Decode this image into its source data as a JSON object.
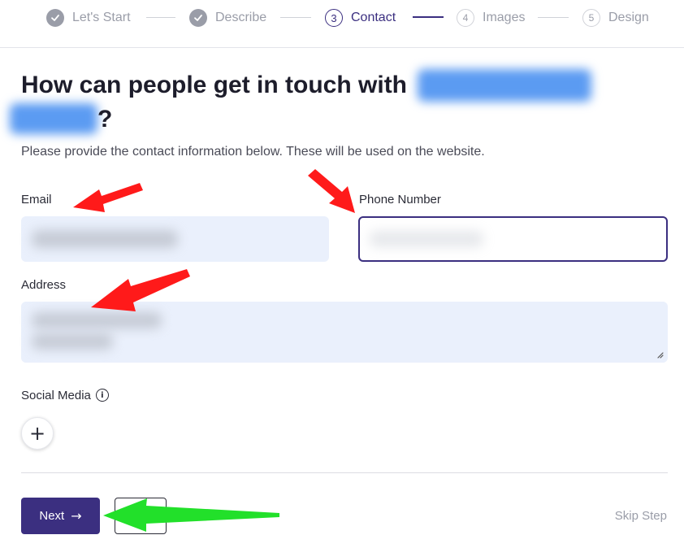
{
  "stepper": {
    "steps": [
      {
        "number": "",
        "label": "Let's Start",
        "state": "done"
      },
      {
        "number": "",
        "label": "Describe",
        "state": "done"
      },
      {
        "number": "3",
        "label": "Contact",
        "state": "current"
      },
      {
        "number": "4",
        "label": "Images",
        "state": "future"
      },
      {
        "number": "5",
        "label": "Design",
        "state": "future"
      }
    ]
  },
  "page": {
    "title_line1": "How can people get in touch with",
    "title_line2_end": "?",
    "subtitle": "Please provide the contact information below. These will be used on the website."
  },
  "form": {
    "email_label": "Email",
    "phone_label": "Phone Number",
    "address_label": "Address",
    "social_label": "Social Media",
    "info_glyph": "i",
    "add_glyph": "+"
  },
  "footer": {
    "next_label": "Next",
    "next_arrow": "→",
    "skip_label": "Skip Step"
  },
  "colors": {
    "accent": "#3b2f80",
    "input_bg": "#eaf0fc",
    "annotation_red": "#ff1a1a",
    "annotation_green": "#22e02a"
  },
  "icons": [
    "check-icon",
    "info-icon",
    "plus-icon",
    "arrow-right-icon",
    "resize-grip-icon",
    "annotation-arrow-icon"
  ]
}
